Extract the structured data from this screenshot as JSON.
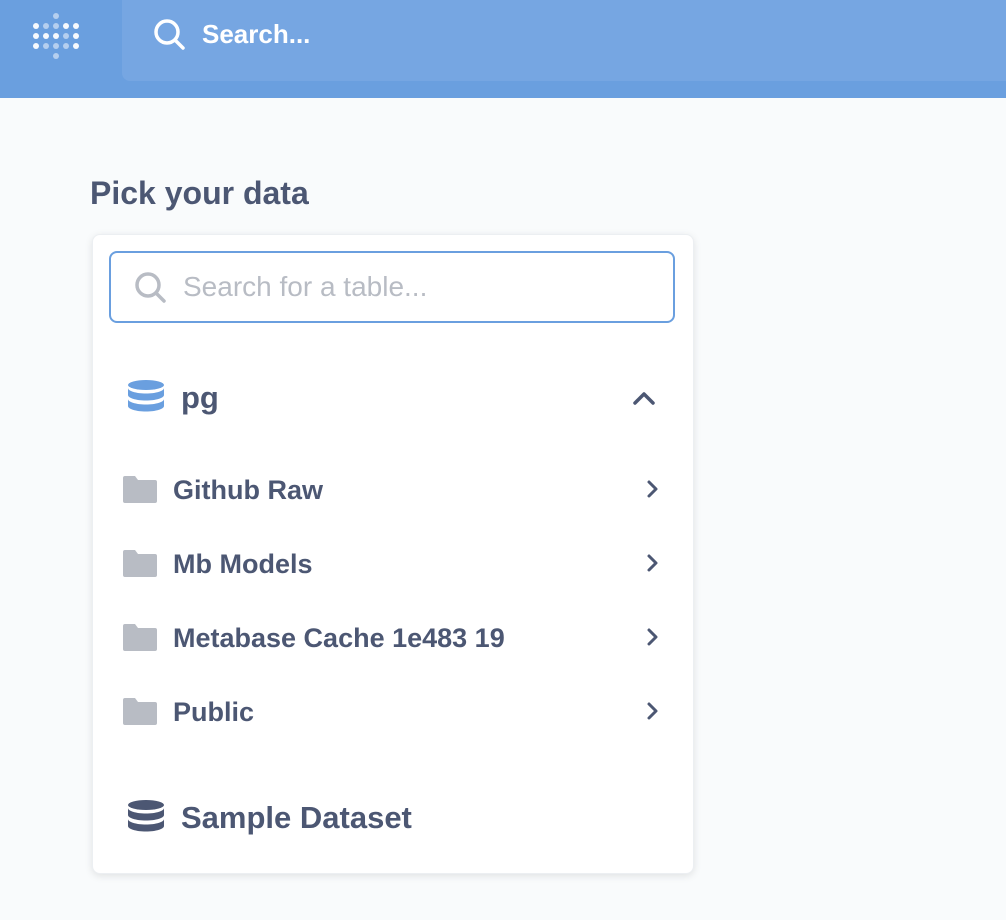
{
  "header": {
    "search_placeholder": "Search...",
    "color": "#6a9fdf"
  },
  "page": {
    "title": "Pick your data"
  },
  "picker": {
    "search_placeholder": "Search for a table...",
    "databases": [
      {
        "label": "pg",
        "icon": "database-icon",
        "expanded": true,
        "icon_color": "#6a9fdf",
        "schemas": [
          {
            "label": "Github Raw",
            "icon": "folder-icon"
          },
          {
            "label": "Mb Models",
            "icon": "folder-icon"
          },
          {
            "label": "Metabase Cache 1e483 19",
            "icon": "folder-icon"
          },
          {
            "label": "Public",
            "icon": "folder-icon"
          }
        ]
      },
      {
        "label": "Sample Dataset",
        "icon": "database-icon",
        "expanded": false,
        "icon_color": "#4c5773"
      }
    ]
  }
}
